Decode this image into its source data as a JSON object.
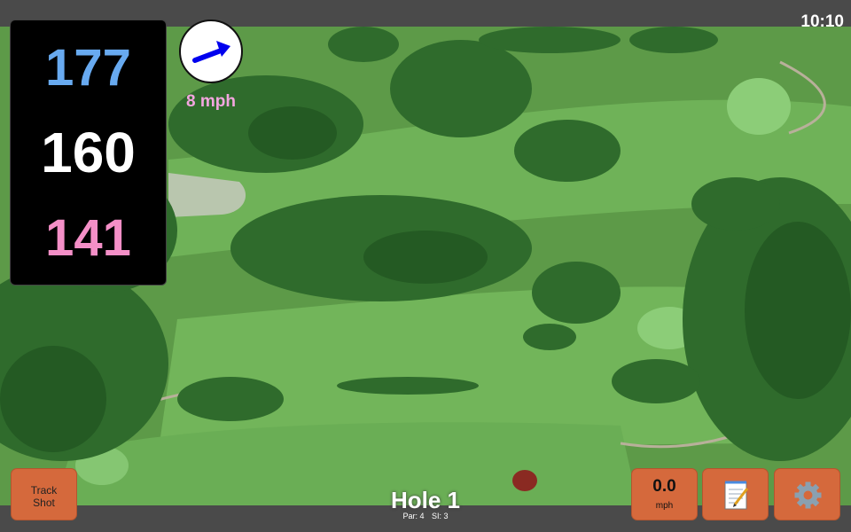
{
  "status": {
    "time": "10:10"
  },
  "yardages": {
    "back": "177",
    "middle": "160",
    "front": "141"
  },
  "wind": {
    "speed_label": "8 mph",
    "direction_icon": "arrow-icon",
    "arrow_color": "#0000ee"
  },
  "hole": {
    "title": "Hole 1",
    "par_label": "Par: 4",
    "si_label": "SI: 3"
  },
  "buttons": {
    "track_shot_line1": "Track",
    "track_shot_line2": "Shot",
    "speed_value": "0.0",
    "speed_unit": "mph",
    "notes_icon": "notepad-icon",
    "settings_icon": "gear-icon"
  },
  "colors": {
    "accent_button": "#d5693c",
    "back_yardage": "#68aaf0",
    "middle_yardage": "#ffffff",
    "front_yardage": "#f48fc7",
    "wind_label": "#f4a6e0"
  }
}
